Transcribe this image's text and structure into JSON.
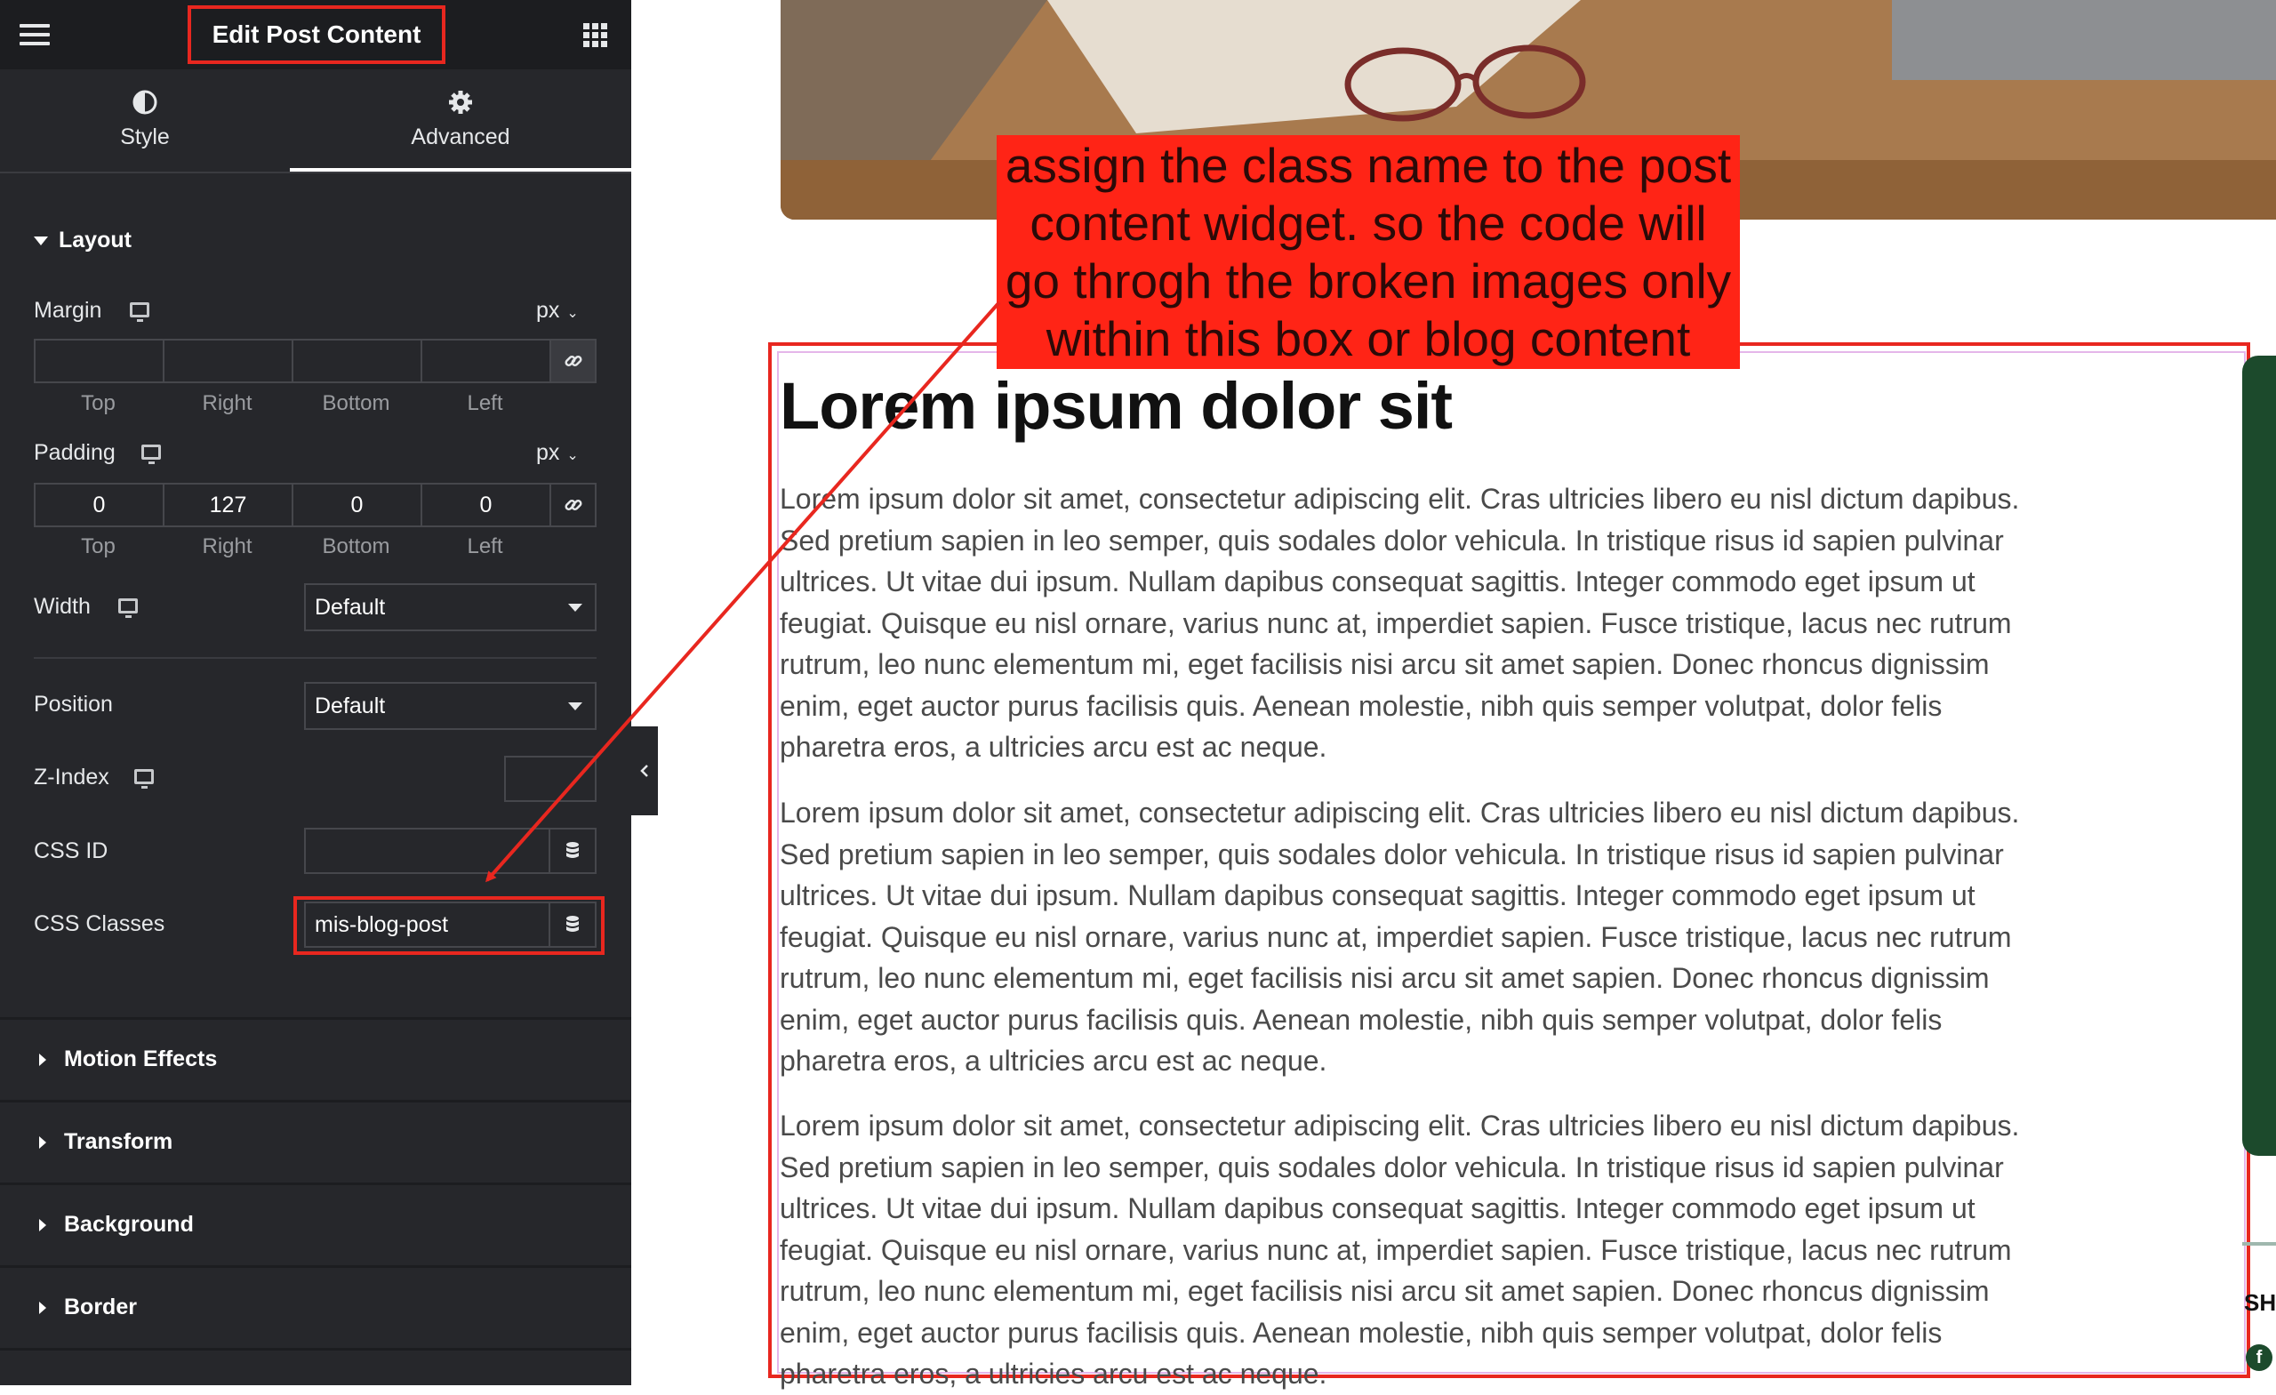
{
  "panel": {
    "title": "Edit Post Content",
    "tabs": [
      {
        "label": "Style",
        "icon": "half-circle-icon"
      },
      {
        "label": "Advanced",
        "icon": "gear-icon",
        "active": true
      }
    ],
    "layout": {
      "section_title": "Layout",
      "margin": {
        "label": "Margin",
        "unit": "px",
        "values": [
          "",
          "",
          "",
          ""
        ]
      },
      "padding": {
        "label": "Padding",
        "unit": "px",
        "values": [
          "0",
          "127",
          "0",
          "0"
        ]
      },
      "sides": [
        "Top",
        "Right",
        "Bottom",
        "Left"
      ],
      "width": {
        "label": "Width",
        "value": "Default"
      },
      "position": {
        "label": "Position",
        "value": "Default"
      },
      "z_index": {
        "label": "Z-Index",
        "value": ""
      },
      "css_id": {
        "label": "CSS ID",
        "value": ""
      },
      "css_classes": {
        "label": "CSS Classes",
        "value": "mis-blog-post"
      }
    },
    "collapsed_sections": [
      "Motion Effects",
      "Transform",
      "Background",
      "Border"
    ]
  },
  "annotation": {
    "text": "assign the class name to the post content widget. so the code will go throgh the broken images only within this box or blog content",
    "color": "#ff2416"
  },
  "preview": {
    "heading": "Lorem ipsum dolor sit",
    "paragraphs": [
      "Lorem ipsum dolor sit amet, consectetur adipiscing elit. Cras ultricies libero eu nisl dictum dapibus. Sed pretium sapien in leo semper, quis sodales dolor vehicula. In tristique risus id sapien pulvinar ultrices. Ut vitae dui ipsum. Nullam dapibus consequat sagittis. Integer commodo eget ipsum ut feugiat. Quisque eu nisl ornare, varius nunc at, imperdiet sapien. Fusce tristique, lacus nec rutrum rutrum, leo nunc elementum mi, eget facilisis nisi arcu sit amet sapien. Donec rhoncus dignissim enim, eget auctor purus facilisis quis. Aenean molestie, nibh quis semper volutpat, dolor felis pharetra eros, a ultricies arcu est ac neque.",
      "Lorem ipsum dolor sit amet, consectetur adipiscing elit. Cras ultricies libero eu nisl dictum dapibus. Sed pretium sapien in leo semper, quis sodales dolor vehicula. In tristique risus id sapien pulvinar ultrices. Ut vitae dui ipsum. Nullam dapibus consequat sagittis. Integer commodo eget ipsum ut feugiat. Quisque eu nisl ornare, varius nunc at, imperdiet sapien. Fusce tristique, lacus nec rutrum rutrum, leo nunc elementum mi, eget facilisis nisi arcu sit amet sapien. Donec rhoncus dignissim enim, eget auctor purus facilisis quis. Aenean molestie, nibh quis semper volutpat, dolor felis pharetra eros, a ultricies arcu est ac neque.",
      "Lorem ipsum dolor sit amet, consectetur adipiscing elit. Cras ultricies libero eu nisl dictum dapibus. Sed pretium sapien in leo semper, quis sodales dolor vehicula. In tristique risus id sapien pulvinar ultrices. Ut vitae dui ipsum. Nullam dapibus consequat sagittis. Integer commodo eget ipsum ut feugiat. Quisque eu nisl ornare, varius nunc at, imperdiet sapien. Fusce tristique, lacus nec rutrum rutrum, leo nunc elementum mi, eget facilisis nisi arcu sit amet sapien. Donec rhoncus dignissim enim, eget auctor purus facilisis quis. Aenean molestie, nibh quis semper volutpat, dolor felis pharetra eros, a ultricies arcu est ac neque."
    ],
    "sidebar_partial_text": "SH"
  },
  "colors": {
    "panel_bg": "#26272b",
    "highlight_red": "#e8271f",
    "body_text": "#4a4a4a"
  }
}
